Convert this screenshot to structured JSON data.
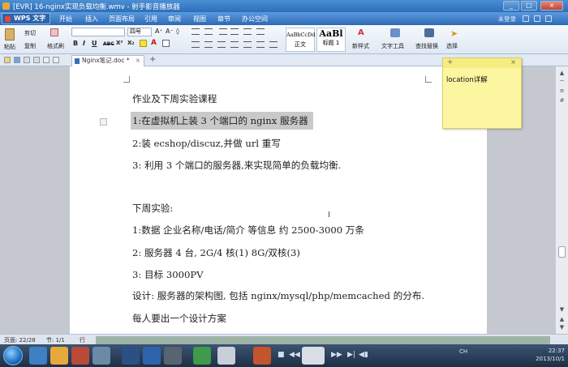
{
  "window": {
    "title": "[EVR] 16-nginx实现负载均衡.wmv - 射手影音播放器",
    "controls": [
      "_",
      "□",
      "×"
    ]
  },
  "menubar": {
    "app_button": "WPS 文字",
    "items": [
      "开始",
      "插入",
      "页面布局",
      "引用",
      "审阅",
      "视图",
      "章节",
      "办公空间"
    ],
    "unsaved": "未登录"
  },
  "ribbon": {
    "paste_label": "粘贴",
    "cut_label": "剪切",
    "copy_label": "复制",
    "format_painter_label": "格式刷",
    "font_size": "四号",
    "format_buttons": [
      "B",
      "I",
      "U",
      "ABC",
      "X²",
      "X₂"
    ],
    "styles": [
      {
        "sample": "AaBbCcDd",
        "label": "正文"
      },
      {
        "sample": "AaBl",
        "label": "标题 1"
      }
    ],
    "new_style_label": "新样式",
    "text_tools_label": "文字工具",
    "find_replace_label": "查找替换",
    "select_label": "选择"
  },
  "tabbar": {
    "doc_tab": "Nginx笔记.doc *",
    "add_tab": "+"
  },
  "document": {
    "lines": [
      "作业及下周实验课程",
      "1:在虚拟机上装 3 个端口的 nginx 服务器",
      "2:装 ecshop/discuz,并做 url 重写",
      "3:  利用 3 个端口的服务器,来实现简单的负载均衡.",
      "下周实验:",
      "1:数据  企业名称/电话/简介  等信息  约 2500-3000 万条",
      "2:  服务器  4 台, 2G/4 核(1)     8G/双核(3)",
      "3:  目标  3000PV",
      "设计: 服务器的架构图, 包括 nginx/mysql/php/memcached 的分布.",
      "每人要出一个设计方案"
    ]
  },
  "sticky_note": {
    "text": "location详解"
  },
  "statusbar": {
    "page": "页面: 22/28",
    "section": "节: 1/1",
    "row": "行"
  },
  "taskbar": {
    "clock_time": "22:37",
    "clock_date": "2013/10/1",
    "tray_label": "CH"
  }
}
